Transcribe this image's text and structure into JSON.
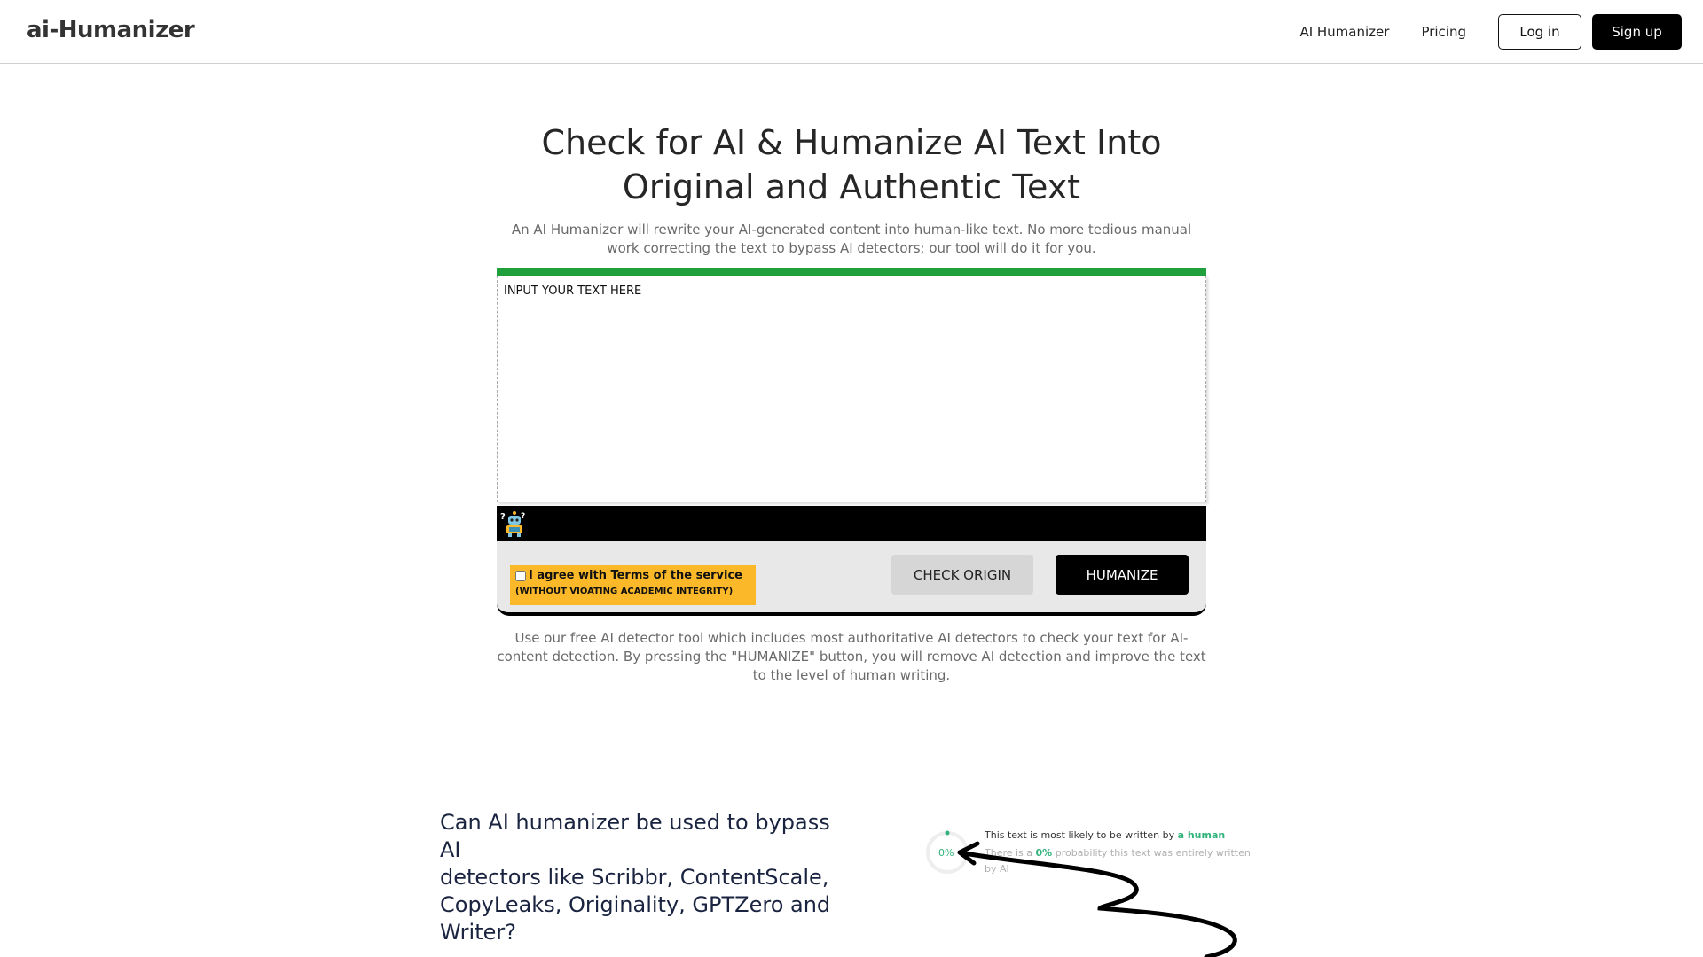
{
  "nav": {
    "logo": "ai-Humanizer",
    "links": [
      "AI Humanizer",
      "Pricing"
    ],
    "login_label": "Log in",
    "signup_label": "Sign up"
  },
  "hero": {
    "title_line1": "Check for AI & Humanize AI Text Into",
    "title_line2": "Original and Authentic Text",
    "subtitle_line1": "An AI Humanizer will rewrite your AI-generated content into human-like text. No more tedious manual",
    "subtitle_line2": "work correcting the text to bypass AI detectors; our tool will do it for you."
  },
  "tool": {
    "progress_percent": 100,
    "input_placeholder": "INPUT YOUR TEXT HERE",
    "terms_label": "I agree with Terms of the service",
    "terms_sub": "(WITHOUT VIOATING ACADEMIC INTEGRITY)",
    "terms_checked": false,
    "check_label": "CHECK ORIGIN",
    "humanize_label": "HUMANIZE",
    "description_line1": "Use our free AI detector tool which includes most authoritative AI detectors to check your text for AI-",
    "description_line2": "content detection. By pressing the \"HUMANIZE\" button, you will remove AI detection and improve the text",
    "description_line3": "to the level of human writing."
  },
  "faq": {
    "heading_line1": "Can AI humanizer be used to bypass AI",
    "heading_line2": "detectors like Scribbr, ContentScale,",
    "heading_line3": "CopyLeaks, Originality, GPTZero and",
    "heading_line4": "Writer?"
  },
  "illustration": {
    "percent": "0%",
    "line1_prefix": "This text is most likely to be written by",
    "line1_highlight": "a human",
    "line2_prefix": "There is a",
    "line2_highlight": "0%",
    "line2_suffix": "probability this text was entirely written by AI"
  },
  "colors": {
    "progress": "#1fa03c",
    "terms_bg": "#fbb92a",
    "accent_green": "#2fb37a",
    "primary_button": "#000000",
    "secondary_button": "#d6d6d6"
  }
}
